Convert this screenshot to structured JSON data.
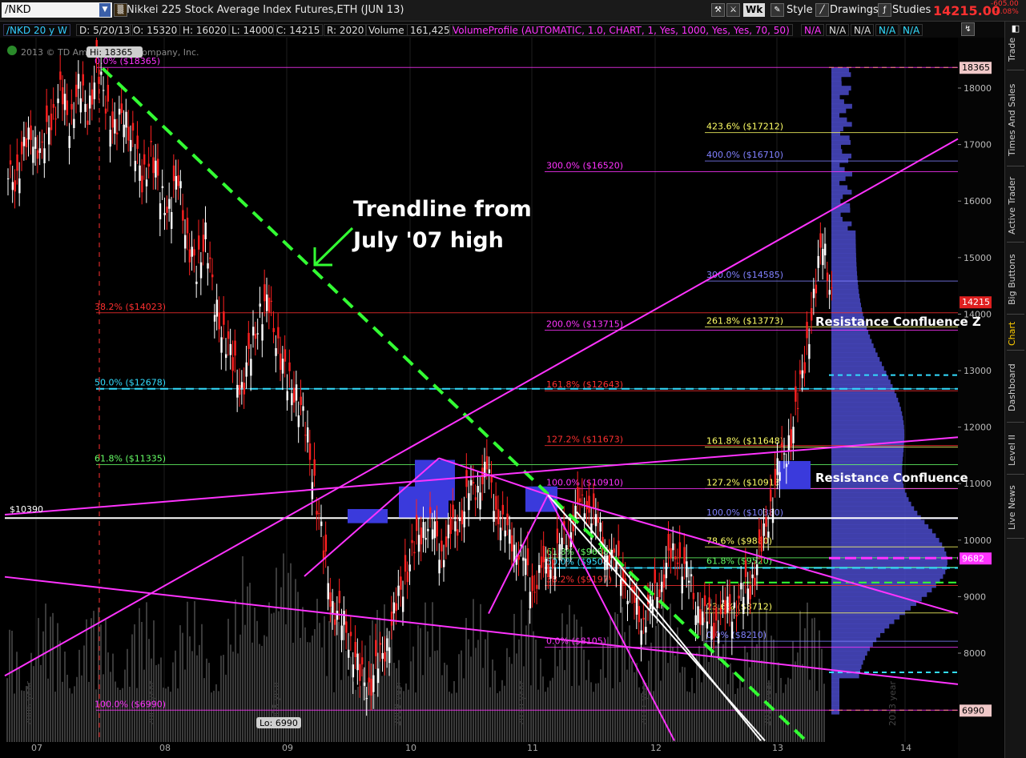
{
  "topbar": {
    "symbol": "/NKD",
    "title": "Nikkei 225 Stock Average Index Futures,ETH (JUN 13)",
    "wk_label": "Wk",
    "style_label": "Style",
    "drawings_label": "Drawings",
    "studies_label": "Studies",
    "last_price": "14215.00",
    "change_abs": "-605.00",
    "change_pct": "-4.08%"
  },
  "studybar": {
    "period": "/NKD 20 y W",
    "date": "D: 5/20/13",
    "open": "O: 15320",
    "high": "H: 16020",
    "low": "L: 14000",
    "close": "C: 14215",
    "range": "R: 2020",
    "volume_label": "Volume",
    "volume_value": "161,425",
    "study": "VolumeProfile (AUTOMATIC, 1.0, CHART, 1, Yes, 1000, Yes, Yes, 70, 50)",
    "na": [
      "N/A",
      "N/A",
      "N/A",
      "N/A",
      "N/A"
    ]
  },
  "right_panel": {
    "tabs": [
      "Trade",
      "Times And Sales",
      "Active Trader",
      "Big Buttons",
      "Chart",
      "Dashboard",
      "Level II",
      "Live News"
    ],
    "active_tab": "Chart"
  },
  "colors": {
    "up": "#ffffff",
    "down": "#ff2020",
    "trendline": "#33ff33",
    "magenta": "#ff33ff",
    "cyan": "#33ddff",
    "profile": "#4a4ac8"
  },
  "chart_data": {
    "type": "candlestick",
    "watermark": "2013 © TD Ameritrade IP Company, Inc.",
    "y_ticks": [
      8000,
      9000,
      10000,
      11000,
      12000,
      13000,
      14000,
      15000,
      16000,
      17000,
      18000
    ],
    "x_ticks": [
      "07",
      "08",
      "09",
      "10",
      "11",
      "12",
      "13",
      "14"
    ],
    "year_labels": [
      "2006 year",
      "2007 year",
      "2008 year",
      "2009 year",
      "2010 year",
      "2011 year",
      "2012 year",
      "2013 year"
    ],
    "price_markers": [
      {
        "label": "18365",
        "value": 18365,
        "color": "#f0c8c8"
      },
      {
        "label": "14215",
        "value": 14215,
        "color": "#e02020"
      },
      {
        "label": "9682",
        "value": 9682,
        "color": "#ff33ff"
      },
      {
        "label": "6990",
        "value": 6990,
        "color": "#f0c8c8"
      }
    ],
    "hi_label": "Hi: 18365",
    "lo_label": "Lo: 6990",
    "key_level_label": "$10390",
    "key_level": 10390,
    "annotation_trendline": [
      "Trendline from",
      "July '07 high"
    ],
    "resistance_labels": [
      "Resistance Confluence Z",
      "Resistance Confluence"
    ],
    "fib_labels": [
      {
        "text": "0.0% ($18365)",
        "value": 18365,
        "color": "#ff33ff"
      },
      {
        "text": "38.2% ($14023)",
        "value": 14023,
        "color": "#ff3030"
      },
      {
        "text": "50.0% ($12678)",
        "value": 12678,
        "color": "#33ddff"
      },
      {
        "text": "61.8% ($11335)",
        "value": 11335,
        "color": "#66ff66"
      },
      {
        "text": "100.0% ($6990)",
        "value": 6990,
        "color": "#ff33ff"
      },
      {
        "text": "423.6% ($17212)",
        "value": 17212,
        "color": "#ffff66"
      },
      {
        "text": "400.0% ($16710)",
        "value": 16710,
        "color": "#8080ff"
      },
      {
        "text": "300.0% ($16520)",
        "value": 16520,
        "color": "#ff33ff"
      },
      {
        "text": "300.0% ($14585)",
        "value": 14585,
        "color": "#8080ff"
      },
      {
        "text": "261.8% ($13773)",
        "value": 13773,
        "color": "#ffff66"
      },
      {
        "text": "200.0% ($13715)",
        "value": 13715,
        "color": "#ff33ff"
      },
      {
        "text": "161.8% ($12643)",
        "value": 12643,
        "color": "#ff3030"
      },
      {
        "text": "127.2% ($11673)",
        "value": 11673,
        "color": "#ff3030"
      },
      {
        "text": "161.8% ($11648)",
        "value": 11648,
        "color": "#ffff66"
      },
      {
        "text": "127.2% ($10913)",
        "value": 10913,
        "color": "#ffff66"
      },
      {
        "text": "100.0% ($10910)",
        "value": 10910,
        "color": "#ff33ff"
      },
      {
        "text": "100.0% ($10380)",
        "value": 10380,
        "color": "#8080ff"
      },
      {
        "text": "78.6% ($9880)",
        "value": 9880,
        "color": "#ffff66"
      },
      {
        "text": "61.8% ($9688)",
        "value": 9688,
        "color": "#66ff66"
      },
      {
        "text": "61.8% ($9520)",
        "value": 9520,
        "color": "#66ff66"
      },
      {
        "text": "50.0% ($9508)",
        "value": 9508,
        "color": "#33ddff"
      },
      {
        "text": "38.2% ($9197)",
        "value": 9197,
        "color": "#ff3030"
      },
      {
        "text": "23.6% ($8712)",
        "value": 8712,
        "color": "#ffff66"
      },
      {
        "text": "0.0% ($8105)",
        "value": 8105,
        "color": "#ff33ff"
      },
      {
        "text": "0.0% ($8210)",
        "value": 8210,
        "color": "#8080ff"
      }
    ],
    "closes": [
      16400,
      16900,
      17200,
      16800,
      17500,
      17900,
      17400,
      18000,
      17600,
      18300,
      17800,
      17200,
      17600,
      17000,
      16400,
      16800,
      16200,
      15800,
      16500,
      15200,
      14800,
      15400,
      14200,
      13600,
      13200,
      12600,
      13400,
      14000,
      14200,
      13400,
      12800,
      12600,
      12000,
      11000,
      9800,
      8800,
      8600,
      8200,
      7600,
      7400,
      7800,
      8200,
      8800,
      9400,
      9800,
      10300,
      10200,
      9800,
      10100,
      10400,
      10800,
      11000,
      11200,
      10600,
      10100,
      10000,
      9600,
      9200,
      9400,
      9600,
      9800,
      10200,
      10500,
      10700,
      10300,
      9900,
      9600,
      9400,
      8900,
      8600,
      8800,
      9200,
      9600,
      9800,
      9400,
      8900,
      8600,
      8500,
      8700,
      8800,
      9000,
      9200,
      9700,
      10400,
      11200,
      11600,
      12200,
      13200,
      14200,
      15400,
      14215
    ]
  }
}
